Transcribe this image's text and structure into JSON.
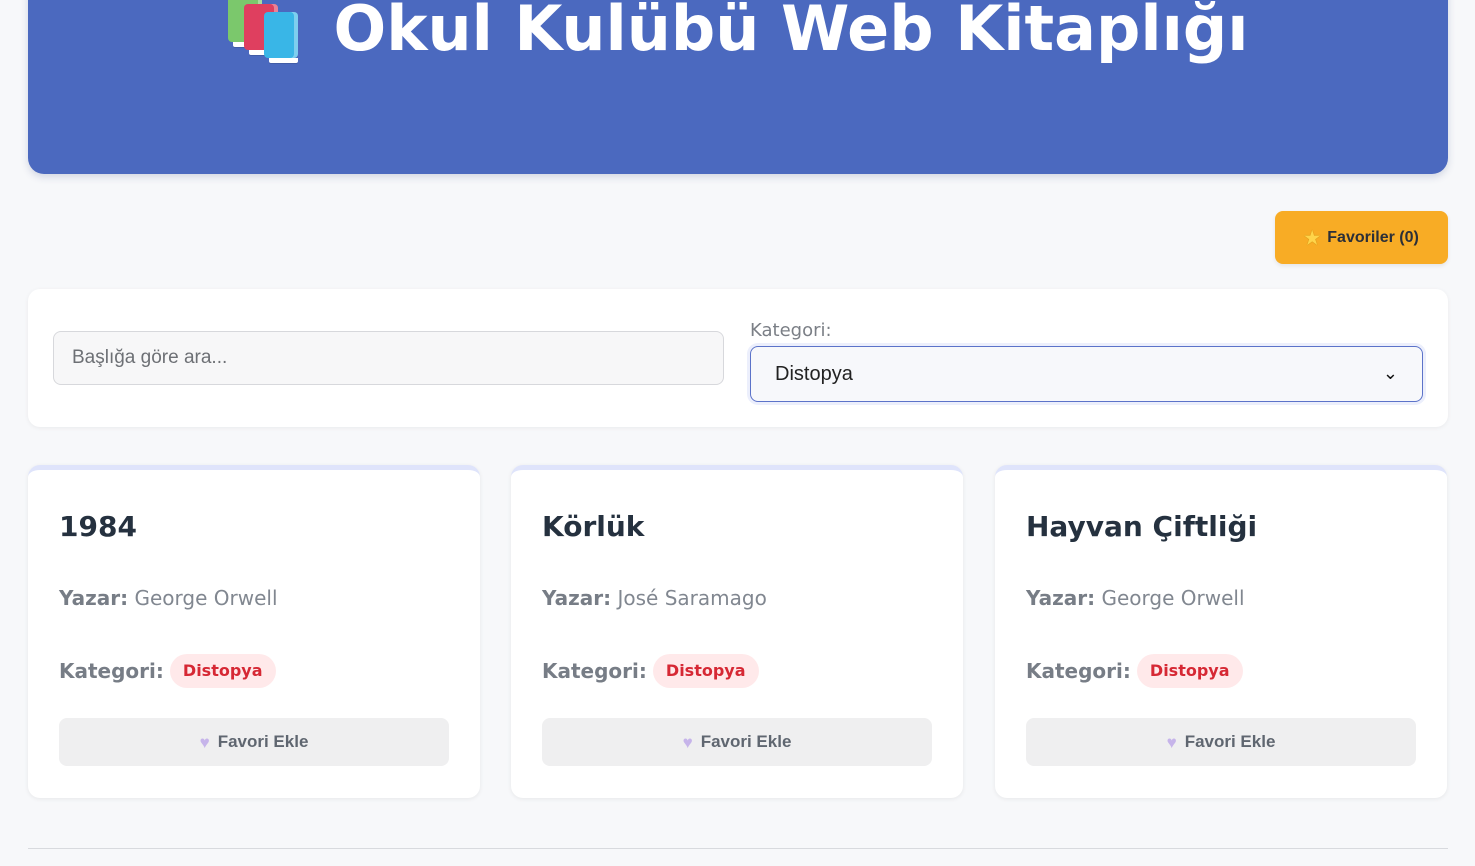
{
  "header": {
    "title": "Okul Kulübü Web Kitaplığı",
    "icon": "books-icon"
  },
  "favorites": {
    "icon": "star-icon",
    "label": "Favoriler (0)"
  },
  "filters": {
    "search": {
      "placeholder": "Başlığa göre ara...",
      "value": ""
    },
    "category_label": "Kategori:",
    "category_selected": "Distopya"
  },
  "cards": [
    {
      "title": "1984",
      "author_label": "Yazar:",
      "author": "George Orwell",
      "category_label": "Kategori:",
      "category": "Distopya",
      "button_label": "Favori Ekle"
    },
    {
      "title": "Körlük",
      "author_label": "Yazar:",
      "author": "José Saramago",
      "category_label": "Kategori:",
      "category": "Distopya",
      "button_label": "Favori Ekle"
    },
    {
      "title": "Hayvan Çiftliği",
      "author_label": "Yazar:",
      "author": "George Orwell",
      "category_label": "Kategori:",
      "category": "Distopya",
      "button_label": "Favori Ekle"
    }
  ],
  "colors": {
    "header": "#4b69bf",
    "favorites_button": "#f8ac25",
    "category_badge_text": "#d62834",
    "category_badge_background": "#ffe9ea",
    "select_border": "#5c73c9"
  },
  "icons": [
    "books-icon",
    "star-icon",
    "chevron-down-icon",
    "heart-icon"
  ]
}
